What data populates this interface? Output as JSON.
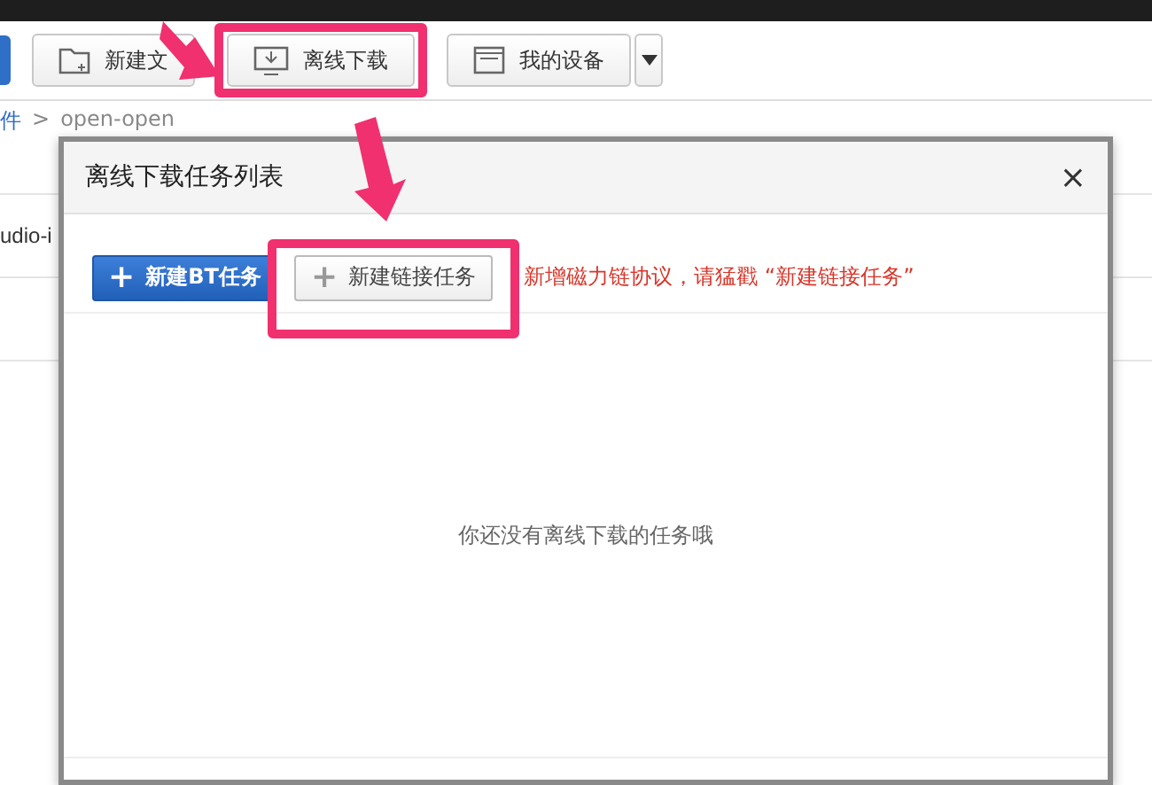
{
  "toolbar": {
    "buttons": [
      {
        "kind": "folder",
        "label": "新建文"
      },
      {
        "kind": "download",
        "label": "离线下载",
        "highlighted": true
      },
      {
        "kind": "device",
        "label": "我的设备",
        "dropdown": true
      }
    ]
  },
  "breadcrumb": {
    "parent": "件",
    "separator": ">",
    "current": "open-open"
  },
  "file_rows": [
    "udio-i"
  ],
  "dialog": {
    "title": "离线下载任务列表",
    "close": "×",
    "buttons": [
      {
        "kind": "primary",
        "icon": "+",
        "label": "新建BT任务",
        "highlighted": false
      },
      {
        "kind": "secondary",
        "icon": "+",
        "label": "新建链接任务",
        "highlighted": true
      }
    ],
    "notice": "新增磁力链协议，请猛戳 “新建链接任务”",
    "empty_message": "你还没有离线下载的任务哦"
  }
}
